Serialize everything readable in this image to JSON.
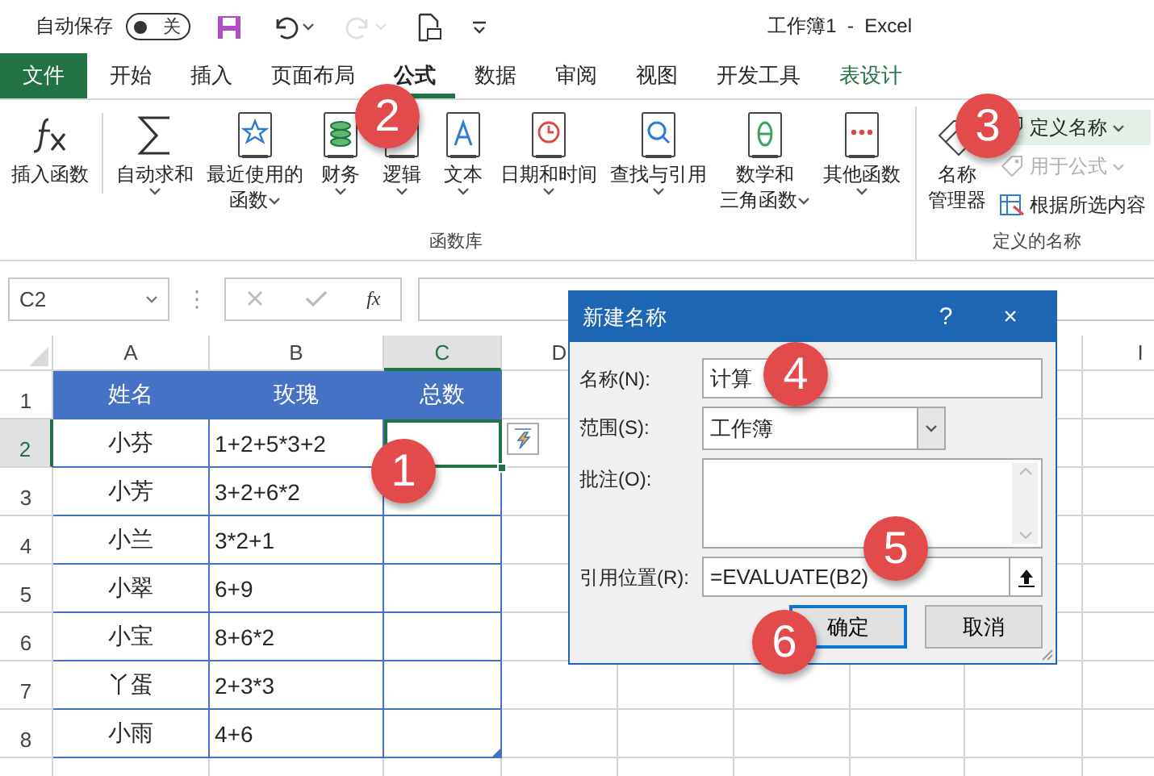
{
  "title_bar": {
    "autosave_label": "自动保存",
    "autosave_toggle": {
      "label": "关",
      "on": false
    },
    "quick_access": [
      {
        "disabled": false,
        "dropdown": false
      },
      {
        "disabled": false,
        "dropdown": true
      },
      {
        "disabled": true,
        "dropdown": true
      },
      {
        "disabled": false,
        "dropdown": false
      },
      {
        "disabled": false,
        "dropdown": false
      }
    ],
    "title": "工作簿1  -  Excel"
  },
  "tabs": [
    {
      "label": "文件",
      "kind": "file",
      "selected": false
    },
    {
      "label": "开始",
      "kind": "normal",
      "selected": false
    },
    {
      "label": "插入",
      "kind": "normal",
      "selected": false
    },
    {
      "label": "页面布局",
      "kind": "normal",
      "selected": false
    },
    {
      "label": "公式",
      "kind": "normal",
      "selected": true
    },
    {
      "label": "数据",
      "kind": "normal",
      "selected": false
    },
    {
      "label": "审阅",
      "kind": "normal",
      "selected": false
    },
    {
      "label": "视图",
      "kind": "normal",
      "selected": false
    },
    {
      "label": "开发工具",
      "kind": "normal",
      "selected": false
    },
    {
      "label": "表设计",
      "kind": "contextual",
      "selected": false
    }
  ],
  "ribbon": {
    "function_library": {
      "label": "函数库",
      "buttons": [
        {
          "lines": [
            "插入函数"
          ],
          "dropdown": false
        },
        {
          "lines": [
            "自动求和"
          ],
          "dropdown": true
        },
        {
          "lines": [
            "最近使用的",
            "函数"
          ],
          "dropdown": true
        },
        {
          "lines": [
            "财务"
          ],
          "dropdown": true
        },
        {
          "lines": [
            "逻辑"
          ],
          "dropdown": true
        },
        {
          "lines": [
            "文本"
          ],
          "dropdown": true
        },
        {
          "lines": [
            "日期和时间"
          ],
          "dropdown": true
        },
        {
          "lines": [
            "查找与引用"
          ],
          "dropdown": true
        },
        {
          "lines": [
            "数学和",
            "三角函数"
          ],
          "dropdown": true
        },
        {
          "lines": [
            "其他函数"
          ],
          "dropdown": true
        }
      ]
    },
    "defined_names": {
      "label": "定义的名称",
      "manager": {
        "lines": [
          "名称",
          "管理器"
        ]
      },
      "small_buttons": [
        {
          "label": "定义名称",
          "dropdown": true,
          "highlighted": true,
          "disabled": false
        },
        {
          "label": "用于公式",
          "dropdown": true,
          "highlighted": false,
          "disabled": true
        },
        {
          "label": "根据所选内容",
          "dropdown": false,
          "highlighted": false,
          "disabled": false
        }
      ]
    }
  },
  "formula_bar": {
    "name_box": "C2",
    "separator": "⋮",
    "insert_function": "fx"
  },
  "sheet": {
    "columns": [
      {
        "label": "A",
        "selected": false
      },
      {
        "label": "B",
        "selected": false
      },
      {
        "label": "C",
        "selected": true
      },
      {
        "label": "D",
        "selected": false
      },
      {
        "label": "I",
        "selected": false
      }
    ],
    "header_row": {
      "number": "1",
      "selected": false,
      "cells": [
        "姓名",
        "玫瑰",
        "总数"
      ]
    },
    "rows": [
      {
        "number": "2",
        "selected": true,
        "name": "小芬",
        "formula": "1+2+5*3+2",
        "total_selected": true
      },
      {
        "number": "3",
        "selected": false,
        "name": "小芳",
        "formula": "3+2+6*2",
        "total_selected": false
      },
      {
        "number": "4",
        "selected": false,
        "name": "小兰",
        "formula": "3*2+1",
        "total_selected": false
      },
      {
        "number": "5",
        "selected": false,
        "name": "小翠",
        "formula": "6+9",
        "total_selected": false
      },
      {
        "number": "6",
        "selected": false,
        "name": "小宝",
        "formula": "8+6*2",
        "total_selected": false
      },
      {
        "number": "7",
        "selected": false,
        "name": "丫蛋",
        "formula": "2+3*3",
        "total_selected": false
      },
      {
        "number": "8",
        "selected": false,
        "name": "小雨",
        "formula": "4+6",
        "total_selected": false
      }
    ]
  },
  "dialog": {
    "title": "新建名称",
    "help": "?",
    "close": "×",
    "name": {
      "label": "名称(N):",
      "value": "计算"
    },
    "scope": {
      "label": "范围(S):",
      "value": "工作簿"
    },
    "comment": {
      "label": "批注(O):"
    },
    "refers_to": {
      "label": "引用位置(R):",
      "value": "=EVALUATE(B2)"
    },
    "buttons": [
      {
        "label": "确定",
        "default": true
      },
      {
        "label": "取消",
        "default": false
      }
    ]
  },
  "annotations": [
    {
      "label": "1"
    },
    {
      "label": "2"
    },
    {
      "label": "3"
    },
    {
      "label": "4"
    },
    {
      "label": "5"
    },
    {
      "label": "6"
    }
  ]
}
